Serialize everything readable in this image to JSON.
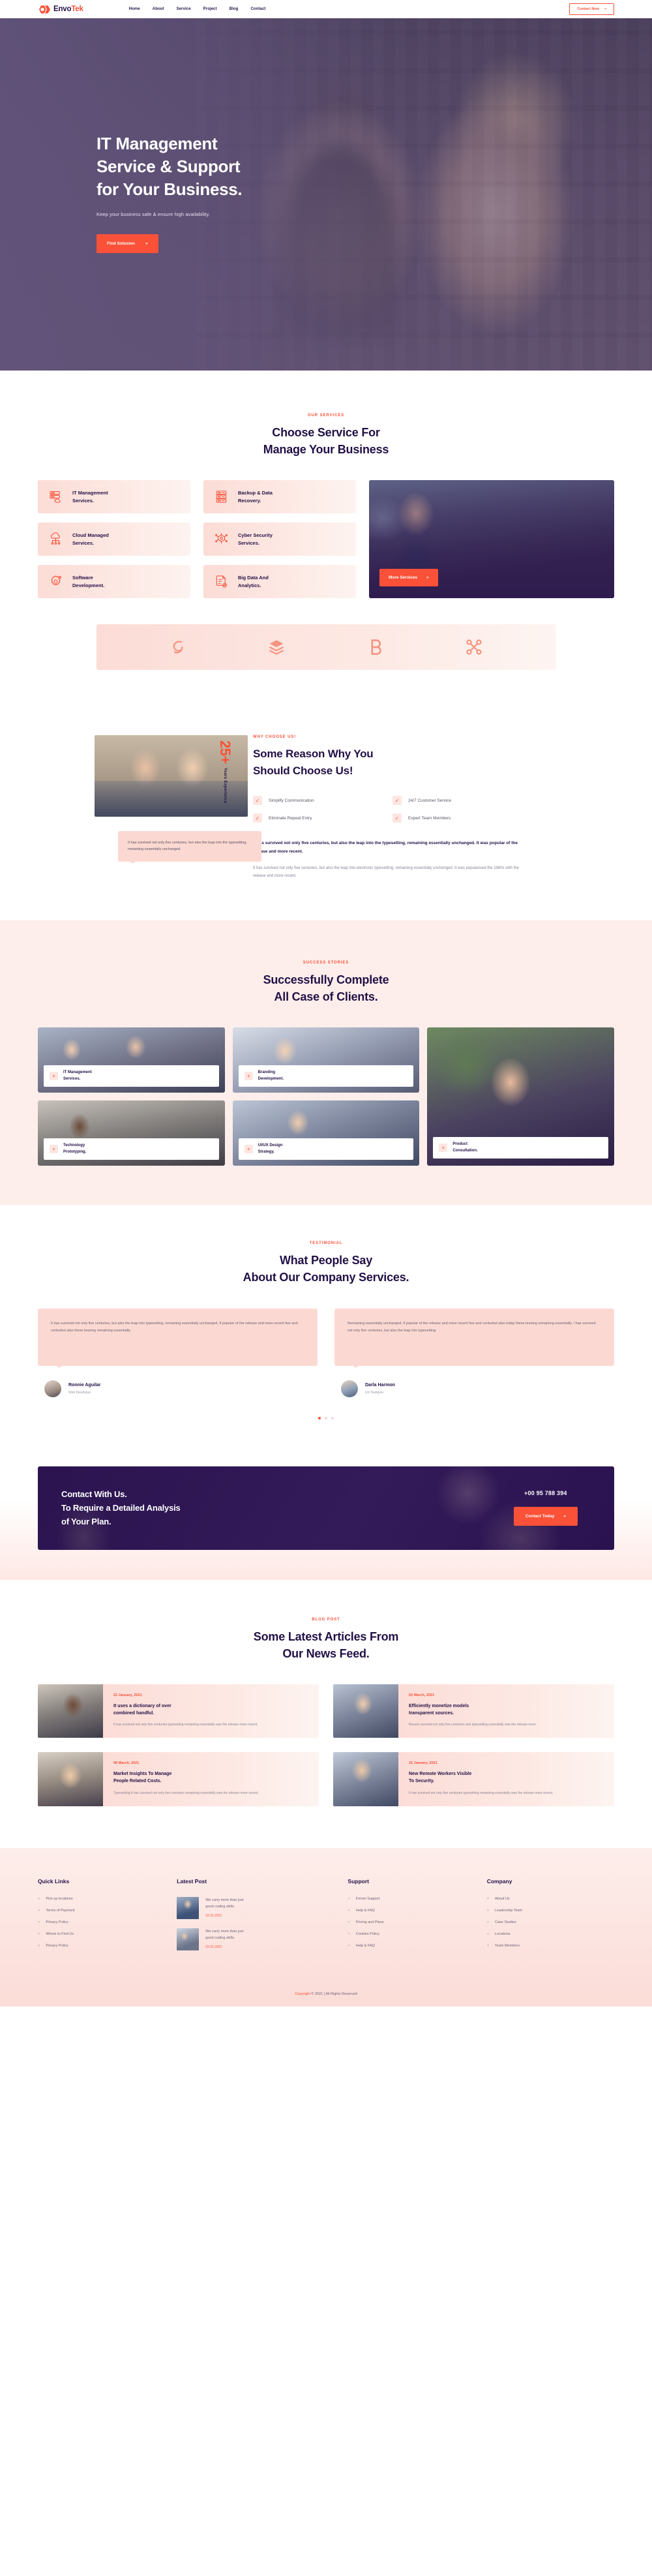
{
  "header": {
    "logo_text_dark": "Envo",
    "logo_text_accent": "Tek",
    "nav": [
      {
        "label": "Home",
        "active": true
      },
      {
        "label": "About",
        "active": false
      },
      {
        "label": "Service",
        "active": false
      },
      {
        "label": "Project",
        "active": false
      },
      {
        "label": "Blog",
        "active": false
      },
      {
        "label": "Contact",
        "active": false
      }
    ],
    "cta_label": "Contact Now",
    "cta_arrow": "»"
  },
  "hero": {
    "title_line1": "IT Management",
    "title_line2": "Service & Support",
    "title_line3": "for Your Business.",
    "subtitle": "Keep your business safe & ensure high availability.",
    "button_label": "Find Solusion",
    "button_arrow": "»"
  },
  "services": {
    "eyebrow": "OUR SERVICES",
    "title_line1": "Choose Service For",
    "title_line2": "Manage Your Business",
    "cards": [
      {
        "label_line1": "IT Management",
        "label_line2": "Services.",
        "icon": "server-hand-icon"
      },
      {
        "label_line1": "Backup & Data",
        "label_line2": "Recovery.",
        "icon": "server-rack-icon"
      },
      {
        "label_line1": "Cloud Managed",
        "label_line2": "Services.",
        "icon": "cloud-network-icon"
      },
      {
        "label_line1": "Cyber Security",
        "label_line2": "Services.",
        "icon": "cyber-shield-icon"
      },
      {
        "label_line1": "Software",
        "label_line2": "Development.",
        "icon": "gear-code-icon"
      },
      {
        "label_line1": "Big Data And",
        "label_line2": "Analytics.",
        "icon": "document-check-icon"
      }
    ],
    "promo_button": "More Services",
    "promo_arrow": "»"
  },
  "brands": [
    {
      "name": "swirl-brand-icon"
    },
    {
      "name": "layers-brand-icon"
    },
    {
      "name": "b-letter-brand-icon"
    },
    {
      "name": "nodes-brand-icon"
    }
  ],
  "why": {
    "badge_number": "25+",
    "badge_label": "Years Experience",
    "quote": "It has survived not only five centuries, but also the leap into the typesetting, remaining essentially unchanged.",
    "eyebrow": "WHY CHOOSE US!",
    "title_line1": "Some Reason Why You",
    "title_line2": "Should Choose Us!",
    "features": [
      "Simplify Communication",
      "24/7 Customer Service",
      "Eliminate Repeat Entry",
      "Expert Team Members"
    ],
    "bold_paragraph": "It has survived not only five centuries, but also the leap into the typesetting, remaining essentially unchanged. It was popular of the release and more recent.",
    "body_paragraph": "It has survived not only five centuries, but also the leap into electronic typesetting, remaining essentially unchanged. It was popularised the 1960s with the release and more recent."
  },
  "success": {
    "eyebrow": "SUCCESS STORIES",
    "title_line1": "Successfully Complete",
    "title_line2": "All Case of Clients.",
    "cases": [
      {
        "label_line1": "IT Management",
        "label_line2": "Services.",
        "plus": "+"
      },
      {
        "label_line1": "Branding",
        "label_line2": "Development.",
        "plus": "+"
      },
      {
        "label_line1": "Technology",
        "label_line2": "Prototyping.",
        "plus": "+"
      },
      {
        "label_line1": "UI/UX Design",
        "label_line2": "Strategy.",
        "plus": "+"
      },
      {
        "label_line1": "Product",
        "label_line2": "Consultation.",
        "plus": "+"
      }
    ]
  },
  "testimonials": {
    "eyebrow": "TESTIMONIAL",
    "title_line1": "What People Say",
    "title_line2": "About Our Company Services.",
    "items": [
      {
        "text": "It has survived not only five centuries, but also the leap into typesetting, remaining essentially unchanged. It popular of the release and more recent five and centurbut also these tesetng remaining essentially.",
        "name": "Ronnie Aguilar",
        "role": "Web Developer"
      },
      {
        "text": "Remaining essentially unchanged. It popular of the release and more recent five and centurbut also today these tesetng remaining essentially. I has survived not only five centuries, but also the leap into typesetting.",
        "name": "Darla Harmon",
        "role": "UX Designer"
      }
    ],
    "dots": 3,
    "active_dot": 0
  },
  "cta": {
    "line1": "Contact With Us.",
    "line2": "To Require a Detailed Analysis",
    "line3": "of Your Plan.",
    "phone": "+00 95 788 394",
    "button_label": "Contact Today",
    "button_arrow": "»"
  },
  "blog": {
    "eyebrow": "BLOG POST",
    "title_line1": "Some Latest Articles From",
    "title_line2": "Our News Feed.",
    "posts": [
      {
        "date": "22 January, 2021",
        "title_line1": "It uses a dictionary of over",
        "title_line2": "combined handful.",
        "excerpt": "It has survived not only five centuries typesetting remaining essentially was the release more recent."
      },
      {
        "date": "02 March, 2021",
        "title_line1": "Efficiently monetize models",
        "title_line2": "transparent sources.",
        "excerpt": "Recent survived not only five centuries and typesetting essentially was the release more"
      },
      {
        "date": "08 March, 2021",
        "title_line1": "Market Insights To Manage",
        "title_line2": "People Related Costs.",
        "excerpt": "Typesetting it has survived not only five centuries remaining essentially was the release more recent."
      },
      {
        "date": "15 January, 2021",
        "title_line1": "New Remote Workers Visible",
        "title_line2": "To Security.",
        "excerpt": "It has survived not only five centuries typesetting remaining essentially was the release more recent."
      }
    ]
  },
  "footer": {
    "columns": [
      {
        "title": "Quick Links",
        "links": [
          "Pick up locations",
          "Terms of Payment",
          "Privacy Policy",
          "Where to Find Us",
          "Privacy Policy"
        ]
      },
      {
        "title": "Support",
        "links": [
          "Forum Support",
          "Help & FAQ",
          "Pricing and Plans",
          "Cookies Policy",
          "Help & FAQ"
        ]
      },
      {
        "title": "Company",
        "links": [
          "About Us",
          "Leadership Team",
          "Case Studies",
          "Locations",
          "Team Members"
        ]
      }
    ],
    "latest_post_title": "Latest Post",
    "latest_posts": [
      {
        "text_line1": "We carry more than just",
        "text_line2": "good coding skills.",
        "date": "22.01.2021"
      },
      {
        "text_line1": "We carry more than just",
        "text_line2": "good coding skills.",
        "date": "22.01.2021"
      }
    ],
    "chevron": "»",
    "copyright_prefix": "Copyright",
    "copyright_rest": "© 2021 | All Rights Reserved"
  },
  "colors": {
    "accent": "#fa5138",
    "dark": "#221046",
    "soft_pink": "#fbd9d2",
    "bg_pink": "#fdeeeb",
    "hero_overlay": "#62547c"
  }
}
